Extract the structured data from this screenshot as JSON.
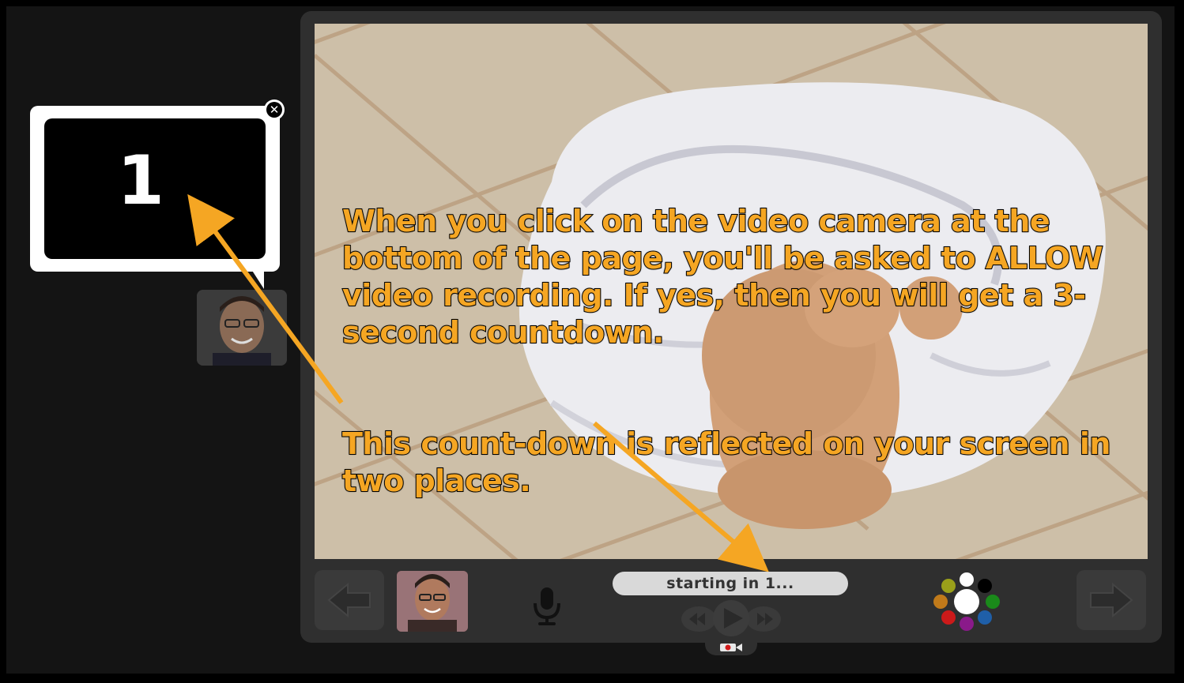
{
  "bubble": {
    "countdown_number": "1",
    "close_label": "✕"
  },
  "slide": {
    "caption_paragraphs": [
      "When you click on the video camera at the bottom of the page, you'll be asked to ALLOW video recording. If yes, then you will get a 3-second countdown.",
      "This count-down is reflected on your screen in two places."
    ]
  },
  "controls": {
    "status_text": "starting in 1...",
    "prev_icon": "arrow-left-icon",
    "next_icon": "arrow-right-icon",
    "mic_icon": "microphone-icon",
    "record_icon": "video-camera-icon",
    "palette_colors": [
      "#ffffff",
      "#000000",
      "#1a8a1a",
      "#1f5fa8",
      "#8a1a8a",
      "#cc1a1a",
      "#c07a1a",
      "#9aa01a"
    ]
  },
  "colors": {
    "caption": "#f5a623",
    "annotation_arrow": "#f5a623",
    "frame": "#2f2f2f",
    "background": "#141414"
  }
}
